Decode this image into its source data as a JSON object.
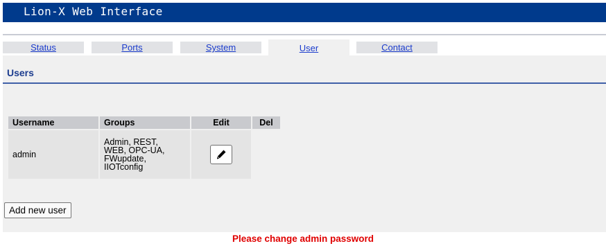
{
  "app": {
    "title": "Lion-X Web Interface"
  },
  "tabs": [
    {
      "label": "Status",
      "active": false
    },
    {
      "label": "Ports",
      "active": false
    },
    {
      "label": "System",
      "active": false
    },
    {
      "label": "User",
      "active": true
    },
    {
      "label": "Contact",
      "active": false
    }
  ],
  "section": {
    "title": "Users"
  },
  "users_table": {
    "columns": [
      "Username",
      "Groups",
      "Edit",
      "Del"
    ],
    "rows": [
      {
        "username": "admin",
        "groups": [
          "Admin, REST,",
          "WEB, OPC-UA,",
          "FWupdate,",
          "IIOTconfig"
        ],
        "edit_icon": "pencil-icon"
      }
    ]
  },
  "actions": {
    "add_user_label": "Add new user"
  },
  "warning": {
    "text": "Please change admin password",
    "color": "#e00000"
  },
  "colors": {
    "title_bar": "#003a8c",
    "link": "#1a3bcc",
    "section_title": "#1d3d8f"
  }
}
